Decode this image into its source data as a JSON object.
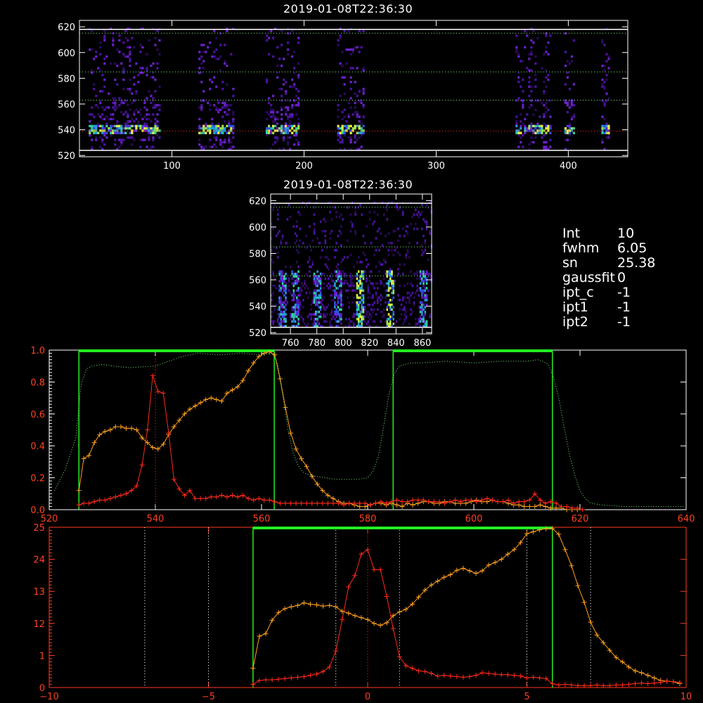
{
  "titles": {
    "top": "2019-01-08T22:36:30",
    "middle": "2019-01-08T22:36:30"
  },
  "info": [
    {
      "key": "Int",
      "value": "10"
    },
    {
      "key": "fwhm",
      "value": "6.05"
    },
    {
      "key": "sn",
      "value": "25.38"
    },
    {
      "key": "gaussfit",
      "value": "0"
    },
    {
      "key": "ipt_c",
      "value": "-1"
    },
    {
      "key": "ipt1",
      "value": "-1"
    },
    {
      "key": "ipt2",
      "value": "-1"
    }
  ],
  "colors": {
    "axis": "#ffffff",
    "red": "#ff2a1a",
    "orange": "#ffa020",
    "green": "#22ee22",
    "dotgreen": "#7cf07c"
  },
  "chart_data": [
    {
      "type": "heatmap",
      "title": "2019-01-08T22:36:30",
      "xlim": [
        30,
        445
      ],
      "ylim": [
        519,
        625
      ],
      "xticks": [
        "100",
        "200",
        "300",
        "400"
      ],
      "yticks": [
        "520",
        "540",
        "560",
        "580",
        "600",
        "620"
      ],
      "xtick_values": [
        100,
        200,
        300,
        400
      ],
      "ytick_values": [
        520,
        540,
        560,
        580,
        600,
        620
      ],
      "hlines_white": [
        524,
        618
      ],
      "hlines_green": [
        615,
        585,
        563
      ],
      "hline_red": 539,
      "columns": [
        [
          37,
          90
        ],
        [
          120,
          147
        ],
        [
          171,
          196
        ],
        [
          225,
          245
        ],
        [
          360,
          386
        ],
        [
          397,
          405
        ],
        [
          425,
          430
        ]
      ]
    },
    {
      "type": "heatmap",
      "title": "2019-01-08T22:36:30",
      "xlim": [
        745,
        867
      ],
      "ylim": [
        519,
        625
      ],
      "xticks": [
        "760",
        "780",
        "800",
        "820",
        "840",
        "860"
      ],
      "yticks": [
        "520",
        "540",
        "560",
        "580",
        "600",
        "620"
      ],
      "xtick_values": [
        760,
        780,
        800,
        820,
        840,
        860
      ],
      "ytick_values": [
        520,
        540,
        560,
        580,
        600,
        620
      ],
      "hlines_white": [
        524,
        618
      ],
      "hlines_green": [
        615,
        585,
        563
      ],
      "streaks": [
        753,
        763,
        780,
        795,
        812,
        835,
        860
      ]
    },
    {
      "type": "line",
      "xlim": [
        520,
        640
      ],
      "ylim": [
        0,
        1.0
      ],
      "xticks": [
        "520",
        "540",
        "560",
        "580",
        "600",
        "620",
        "640"
      ],
      "xtick_values": [
        520,
        540,
        560,
        580,
        600,
        620,
        640
      ],
      "yticks": [
        "0.0",
        "0.2",
        "0.4",
        "0.6",
        "0.8",
        "1.0"
      ],
      "ytick_values": [
        0.0,
        0.2,
        0.4,
        0.6,
        0.8,
        1.0
      ],
      "band_top": 1.0,
      "bands": [
        [
          525.6,
          562.4
        ],
        [
          584.8,
          614.8
        ]
      ],
      "red_vline": 540,
      "series": [
        {
          "color": "orange",
          "x": [
            525.6,
            526.5,
            527.5,
            528.5,
            529.5,
            530.5,
            531.5,
            532.5,
            533.5,
            534.5,
            535.5,
            536.5,
            537.5,
            538.5,
            539.5,
            540.5,
            541.5,
            542.5,
            543.5,
            544.5,
            545.5,
            546.5,
            547.5,
            548.5,
            549.5,
            550.5,
            551.5,
            552.5,
            553.5,
            554.5,
            555.5,
            556.5,
            557.5,
            558.5,
            559.5,
            560.5,
            561.5,
            562.5,
            563.5,
            564.5,
            565.5,
            566.5,
            567.5,
            568.5,
            569.5,
            570.5,
            571.5,
            572.5,
            573.5,
            574.5,
            575.5,
            576.5,
            577.5,
            578.5,
            579.5,
            580.5,
            581.5,
            582.5,
            583.5,
            584.5,
            585.5,
            586.5,
            587.5,
            588.5,
            589.5,
            590.5,
            591.5,
            592.5,
            593.5,
            594.5,
            595.5,
            596.5,
            597.5,
            598.5,
            599.5,
            600.5,
            601.5,
            602.5,
            603.5,
            604.5,
            605.5,
            606.5,
            607.5,
            608.5,
            609.5,
            610.5,
            611.5,
            612.5,
            613.5,
            614.5,
            615.5,
            616.5,
            617.5,
            618.5,
            619.5
          ],
          "y": [
            0.12,
            0.32,
            0.34,
            0.42,
            0.47,
            0.49,
            0.5,
            0.52,
            0.52,
            0.51,
            0.51,
            0.5,
            0.45,
            0.42,
            0.39,
            0.38,
            0.41,
            0.47,
            0.52,
            0.56,
            0.6,
            0.63,
            0.65,
            0.67,
            0.69,
            0.7,
            0.69,
            0.68,
            0.73,
            0.75,
            0.77,
            0.81,
            0.87,
            0.92,
            0.96,
            0.98,
            0.99,
            0.97,
            0.82,
            0.64,
            0.48,
            0.38,
            0.32,
            0.27,
            0.21,
            0.16,
            0.12,
            0.09,
            0.07,
            0.05,
            0.04,
            0.04,
            0.03,
            0.02,
            0.02,
            0.03,
            0.04,
            0.04,
            0.03,
            0.04,
            0.03,
            0.02,
            0.04,
            0.03,
            0.04,
            0.05,
            0.05,
            0.04,
            0.04,
            0.05,
            0.05,
            0.04,
            0.04,
            0.04,
            0.05,
            0.06,
            0.05,
            0.05,
            0.06,
            0.05,
            0.05,
            0.04,
            0.03,
            0.03,
            0.02,
            0.02,
            0.02,
            0.03,
            0.02,
            0.01,
            0.01,
            0.01,
            0.0,
            0.0,
            0.0
          ]
        },
        {
          "color": "red",
          "x": [
            525.6,
            526.5,
            527.5,
            528.5,
            529.5,
            530.5,
            531.5,
            532.5,
            533.5,
            534.5,
            535.5,
            536.5,
            537.5,
            538.5,
            539.5,
            540.5,
            541.5,
            542.5,
            543.5,
            544.5,
            545.5,
            546.5,
            547.5,
            548.5,
            549.5,
            550.5,
            551.5,
            552.5,
            553.5,
            554.5,
            555.5,
            556.5,
            557.5,
            558.5,
            559.5,
            560.5,
            561.5,
            562.5,
            563.5,
            564.5,
            565.5,
            566.5,
            567.5,
            568.5,
            569.5,
            570.5,
            571.5,
            572.5,
            573.5,
            574.5,
            575.5,
            576.5,
            577.5,
            578.5,
            579.5,
            580.5,
            581.5,
            582.5,
            583.5,
            584.5,
            585.5,
            586.5,
            587.5,
            588.5,
            589.5,
            590.5,
            591.5,
            592.5,
            593.5,
            594.5,
            595.5,
            596.5,
            597.5,
            598.5,
            599.5,
            600.5,
            601.5,
            602.5,
            603.5,
            604.5,
            605.5,
            606.5,
            607.5,
            608.5,
            609.5,
            610.5,
            611.5,
            612.5,
            613.5,
            614.5,
            615.5,
            616.5,
            617.5,
            618.5,
            619.5,
            620.5
          ],
          "y": [
            0.03,
            0.04,
            0.04,
            0.05,
            0.06,
            0.06,
            0.07,
            0.08,
            0.09,
            0.1,
            0.12,
            0.15,
            0.28,
            0.5,
            0.84,
            0.74,
            0.73,
            0.48,
            0.19,
            0.13,
            0.09,
            0.12,
            0.07,
            0.07,
            0.07,
            0.08,
            0.08,
            0.09,
            0.08,
            0.09,
            0.08,
            0.09,
            0.07,
            0.06,
            0.07,
            0.06,
            0.06,
            0.05,
            0.04,
            0.04,
            0.04,
            0.04,
            0.04,
            0.04,
            0.04,
            0.04,
            0.04,
            0.04,
            0.04,
            0.04,
            0.03,
            0.04,
            0.04,
            0.04,
            0.04,
            0.03,
            0.04,
            0.05,
            0.04,
            0.05,
            0.06,
            0.05,
            0.05,
            0.06,
            0.06,
            0.06,
            0.05,
            0.05,
            0.05,
            0.04,
            0.05,
            0.06,
            0.05,
            0.06,
            0.06,
            0.05,
            0.06,
            0.07,
            0.06,
            0.05,
            0.05,
            0.06,
            0.04,
            0.05,
            0.05,
            0.06,
            0.1,
            0.06,
            0.04,
            0.05,
            0.04,
            0.02,
            0.02,
            0.01,
            0.01,
            0.0
          ]
        },
        {
          "color": "dotgreen",
          "style": "dotted",
          "x": [
            521,
            523,
            525,
            526,
            527,
            528,
            530,
            532,
            535,
            540,
            545,
            548,
            552,
            556,
            560,
            562,
            563,
            564,
            565,
            566,
            567,
            568,
            570,
            572,
            574,
            576,
            578,
            580,
            581,
            582,
            583,
            584,
            585,
            586,
            588,
            590,
            595,
            600,
            605,
            610,
            612,
            613,
            614,
            615,
            616,
            617,
            618,
            619,
            620,
            621,
            622,
            624,
            628,
            632,
            636,
            639.5
          ],
          "y": [
            0.12,
            0.25,
            0.45,
            0.78,
            0.88,
            0.9,
            0.91,
            0.9,
            0.89,
            0.9,
            0.96,
            0.98,
            0.97,
            0.98,
            0.97,
            0.98,
            0.92,
            0.72,
            0.5,
            0.35,
            0.27,
            0.23,
            0.21,
            0.2,
            0.19,
            0.19,
            0.19,
            0.2,
            0.24,
            0.33,
            0.52,
            0.72,
            0.85,
            0.9,
            0.92,
            0.92,
            0.93,
            0.92,
            0.93,
            0.93,
            0.94,
            0.93,
            0.91,
            0.83,
            0.7,
            0.52,
            0.35,
            0.22,
            0.12,
            0.07,
            0.04,
            0.03,
            0.02,
            0.02,
            0.02,
            0.02
          ]
        }
      ]
    },
    {
      "type": "line",
      "xlim": [
        -10,
        10
      ],
      "ylim": [
        0,
        25
      ],
      "xticks": [
        "−10",
        "−5",
        "0",
        "5",
        "10"
      ],
      "xtick_values": [
        -10,
        -5,
        0,
        5,
        10
      ],
      "yticks": [
        "0",
        "1",
        "12",
        "13",
        "24",
        "25"
      ],
      "ytick_values": [
        0,
        5,
        10,
        15,
        20,
        25
      ],
      "band_top": 25,
      "bands": [
        [
          -3.6,
          5.8
        ]
      ],
      "vlines_white": [
        -7,
        -5,
        -1,
        1,
        5,
        7
      ],
      "red_vline": 0,
      "series": [
        {
          "color": "orange",
          "x": [
            -3.6,
            -3.4,
            -3.2,
            -3.0,
            -2.8,
            -2.6,
            -2.4,
            -2.2,
            -2.0,
            -1.8,
            -1.6,
            -1.4,
            -1.2,
            -1.0,
            -0.8,
            -0.6,
            -0.4,
            -0.2,
            0.0,
            0.2,
            0.4,
            0.6,
            0.8,
            1.0,
            1.2,
            1.4,
            1.6,
            1.8,
            2.0,
            2.2,
            2.4,
            2.6,
            2.8,
            3.0,
            3.2,
            3.4,
            3.6,
            3.8,
            4.0,
            4.2,
            4.4,
            4.6,
            4.8,
            5.0,
            5.2,
            5.4,
            5.6,
            5.8,
            6.0,
            6.2,
            6.4,
            6.6,
            6.8,
            7.0,
            7.2,
            7.4,
            7.6,
            7.8,
            8.0,
            8.2,
            8.4,
            8.6,
            8.8,
            9.0,
            9.2,
            9.4,
            9.6,
            9.8
          ],
          "y": [
            3.0,
            8.0,
            8.4,
            10.5,
            11.7,
            12.3,
            12.6,
            12.8,
            13.2,
            13.0,
            12.9,
            12.7,
            12.8,
            12.6,
            11.9,
            11.6,
            11.2,
            10.9,
            10.6,
            10.0,
            9.7,
            10.1,
            11.2,
            11.8,
            12.2,
            13.0,
            14.1,
            15.2,
            16.0,
            16.6,
            17.2,
            17.6,
            18.3,
            18.6,
            18.2,
            17.8,
            18.2,
            19.1,
            19.5,
            20.0,
            20.8,
            21.5,
            22.6,
            24.0,
            24.3,
            24.6,
            24.8,
            24.8,
            23.9,
            21.5,
            19.0,
            15.9,
            13.3,
            10.2,
            8.2,
            7.0,
            5.8,
            4.7,
            4.0,
            3.2,
            2.6,
            2.3,
            1.9,
            1.5,
            1.1,
            1.0,
            0.9,
            0.6
          ]
        },
        {
          "color": "red",
          "x": [
            -3.6,
            -3.4,
            -3.2,
            -3.0,
            -2.8,
            -2.6,
            -2.4,
            -2.2,
            -2.0,
            -1.8,
            -1.6,
            -1.4,
            -1.2,
            -1.0,
            -0.8,
            -0.6,
            -0.4,
            -0.2,
            0.0,
            0.2,
            0.4,
            0.6,
            0.8,
            1.0,
            1.2,
            1.4,
            1.6,
            1.8,
            2.0,
            2.2,
            2.4,
            2.6,
            2.8,
            3.0,
            3.2,
            3.4,
            3.6,
            3.8,
            4.0,
            4.2,
            4.4,
            4.6,
            4.8,
            5.0,
            5.2,
            5.4,
            5.6,
            5.8,
            6.0,
            6.2,
            6.4,
            6.6,
            6.8,
            7.0,
            7.2,
            7.4,
            7.6,
            7.8,
            8.0,
            8.2,
            8.4,
            8.6,
            8.8,
            9.0,
            9.2,
            9.4,
            9.6,
            9.8
          ],
          "y": [
            0.5,
            1.1,
            1.2,
            1.2,
            1.3,
            1.4,
            1.5,
            1.6,
            1.7,
            1.9,
            2.1,
            2.5,
            3.2,
            5.7,
            10.6,
            15.7,
            17.5,
            20.8,
            21.5,
            18.4,
            18.4,
            14.2,
            9.2,
            4.8,
            3.4,
            3.0,
            2.6,
            2.5,
            2.2,
            1.8,
            1.9,
            1.8,
            1.7,
            1.6,
            1.7,
            1.9,
            2.3,
            2.2,
            2.1,
            2.0,
            2.0,
            1.9,
            1.8,
            1.5,
            1.6,
            1.5,
            1.4,
            0.6,
            0.4,
            0.5,
            0.4,
            0.3,
            0.3,
            0.3,
            0.4,
            0.3,
            0.3,
            0.4,
            0.4,
            0.5,
            0.6,
            0.7,
            0.6,
            0.7,
            0.8,
            1.0,
            0.9,
            0.8
          ]
        }
      ]
    }
  ]
}
